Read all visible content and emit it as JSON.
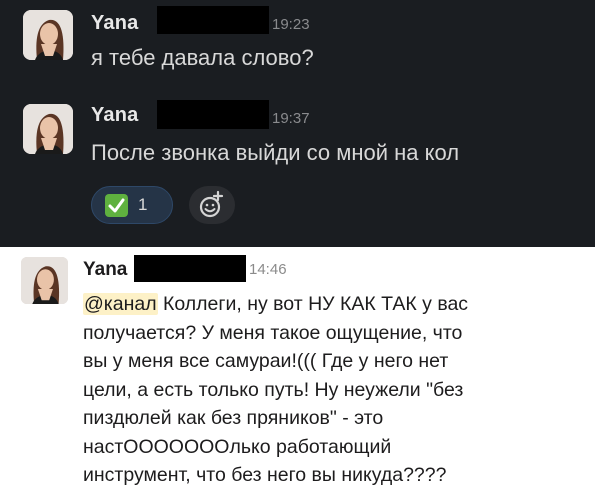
{
  "colors": {
    "dark_bg": "#1a1d21",
    "light_bg": "#ffffff",
    "mention_bg": "#fdf1c7",
    "reaction_bg": "#253447",
    "check_green": "#5fb13f"
  },
  "messages": [
    {
      "author": "Yana",
      "time": "19:23",
      "text": "я тебе давала слово?"
    },
    {
      "author": "Yana",
      "time": "19:37",
      "text": "После звонка выйди со мной на кол",
      "reaction": {
        "emoji": "check-mark-icon",
        "count": "1"
      },
      "add_reaction_icon": "add-emoji-icon"
    },
    {
      "author": "Yana",
      "time": "14:46",
      "mention": "@канал",
      "lines": [
        " Коллеги, ну вот НУ КАК ТАК у вас",
        "получается? У меня такое ощущение, что",
        "вы у меня все самураи!((( Где у него нет",
        "цели, а есть только путь! Ну неужели \"без",
        "пиздюлей как без пряников\" - это",
        "настООООООOлько работающий",
        "инструмент, что без него вы никуда????"
      ]
    }
  ]
}
